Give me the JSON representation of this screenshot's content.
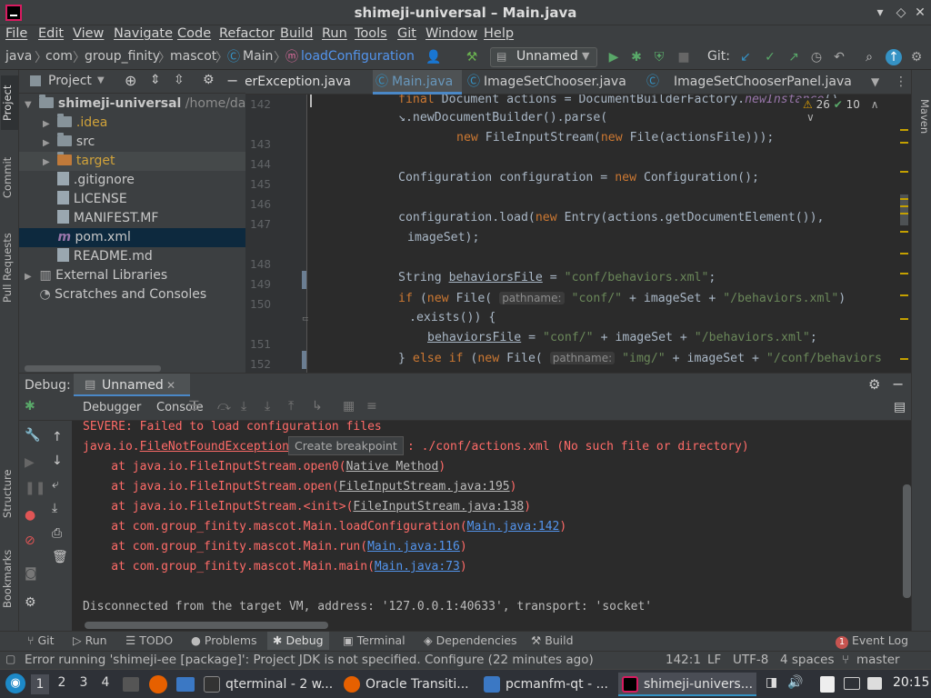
{
  "window": {
    "title": "shimeji-universal – Main.java"
  },
  "menu": [
    "File",
    "Edit",
    "View",
    "Navigate",
    "Code",
    "Refactor",
    "Build",
    "Run",
    "Tools",
    "Git",
    "Window",
    "Help"
  ],
  "breadcrumb": [
    "java",
    "com",
    "group_finity",
    "mascot",
    "Main",
    "loadConfiguration"
  ],
  "run_config": "Unnamed",
  "git_label": "Git:",
  "project_panel": {
    "title": "Project",
    "tree": [
      {
        "label": "shimeji-universal",
        "extra": "/home/dartz",
        "indent": 0,
        "bold": true
      },
      {
        "label": ".idea",
        "indent": 1,
        "color": "#d0a23a"
      },
      {
        "label": "src",
        "indent": 1
      },
      {
        "label": "target",
        "indent": 1,
        "color": "#d0a23a",
        "selected": true
      },
      {
        "label": ".gitignore",
        "indent": 1
      },
      {
        "label": "LICENSE",
        "indent": 1
      },
      {
        "label": "MANIFEST.MF",
        "indent": 1
      },
      {
        "label": "pom.xml",
        "indent": 1,
        "active": true
      },
      {
        "label": "README.md",
        "indent": 1
      },
      {
        "label": "External Libraries",
        "indent": 0
      },
      {
        "label": "Scratches and Consoles",
        "indent": 0
      }
    ]
  },
  "side_tabs": {
    "project": "Project",
    "commit": "Commit",
    "pull": "Pull Requests",
    "structure": "Structure",
    "bookmarks": "Bookmarks",
    "maven": "Maven"
  },
  "editor": {
    "tabs": [
      "erException.java",
      "Main.java",
      "ImageSetChooser.java",
      "ImageSetChooserPanel.java"
    ],
    "inspections": {
      "warnings": "26",
      "ok": "10"
    },
    "line_numbers": [
      "142",
      "",
      "143",
      "144",
      "145",
      "146",
      "147",
      "",
      "148",
      "149",
      "150",
      "",
      "151",
      "152"
    ]
  },
  "debug": {
    "title": "Debug:",
    "session": "Unnamed",
    "tabs": [
      "Debugger",
      "Console"
    ],
    "tooltip": "Create breakpoint",
    "console": {
      "l0": "SEVERE: Failed to load configuration files",
      "l1a": "java.io.",
      "l1b": "FileNotFoundException",
      "l1c": ": ./conf/actions.xml (No such file or directory)",
      "l2a": "    at java.io.FileInputStream.open0(",
      "l2b": "Native Method",
      "l3a": "    at java.io.FileInputStream.open(",
      "l3b": "FileInputStream.java:195",
      "l4a": "    at java.io.FileInputStream.<init>(",
      "l4b": "FileInputStream.java:138",
      "l5a": "    at com.group_finity.mascot.Main.loadConfiguration(",
      "l5b": "Main.java:142",
      "l6a": "    at com.group_finity.mascot.Main.run(",
      "l6b": "Main.java:116",
      "l7a": "    at com.group_finity.mascot.Main.main(",
      "l7b": "Main.java:73",
      "close": ")",
      "l8": "Disconnected from the target VM, address: '127.0.0.1:40633', transport: 'socket'"
    }
  },
  "tool_tabs": [
    "Git",
    "Run",
    "TODO",
    "Problems",
    "Debug",
    "Terminal",
    "Dependencies",
    "Build"
  ],
  "event_log": {
    "label": "Event Log",
    "count": "1"
  },
  "status": {
    "message": "Error running 'shimeji-ee [package]': Project JDK is not specified. Configure (22 minutes ago)",
    "position": "142:1",
    "line_sep": "LF",
    "encoding": "UTF-8",
    "indent": "4 spaces",
    "branch": "master"
  },
  "taskbar": {
    "workspaces": [
      "1",
      "2",
      "3",
      "4"
    ],
    "tasks": [
      "qterminal - 2 w...",
      "Oracle Transiti...",
      "pcmanfm-qt - ...",
      "shimeji-univers..."
    ],
    "clock": "20:15"
  },
  "colors": {
    "accent": "#3592c4",
    "selection": "#0d293e",
    "error": "#ff6b68",
    "link": "#5394ec"
  }
}
